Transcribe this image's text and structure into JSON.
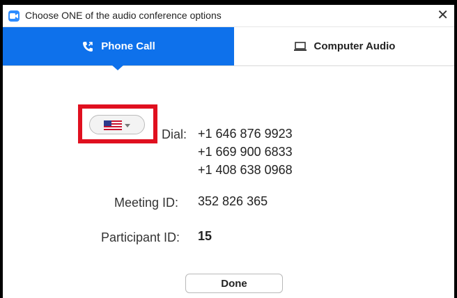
{
  "window": {
    "title": "Choose ONE of the audio conference options"
  },
  "tabs": [
    {
      "label": "Phone Call",
      "icon": "phone-icon",
      "active": true
    },
    {
      "label": "Computer Audio",
      "icon": "laptop-icon",
      "active": false
    }
  ],
  "phone": {
    "country_icon": "us-flag-icon",
    "dial_label": "Dial:",
    "dial_numbers": [
      "+1 646 876 9923",
      "+1 669 900 6833",
      "+1 408 638 0968"
    ],
    "meeting_id_label": "Meeting ID:",
    "meeting_id": "352 826 365",
    "participant_id_label": "Participant ID:",
    "participant_id": "15"
  },
  "buttons": {
    "done_label": "Done"
  },
  "colors": {
    "accent": "#0e71eb",
    "highlight": "#e0101f"
  }
}
